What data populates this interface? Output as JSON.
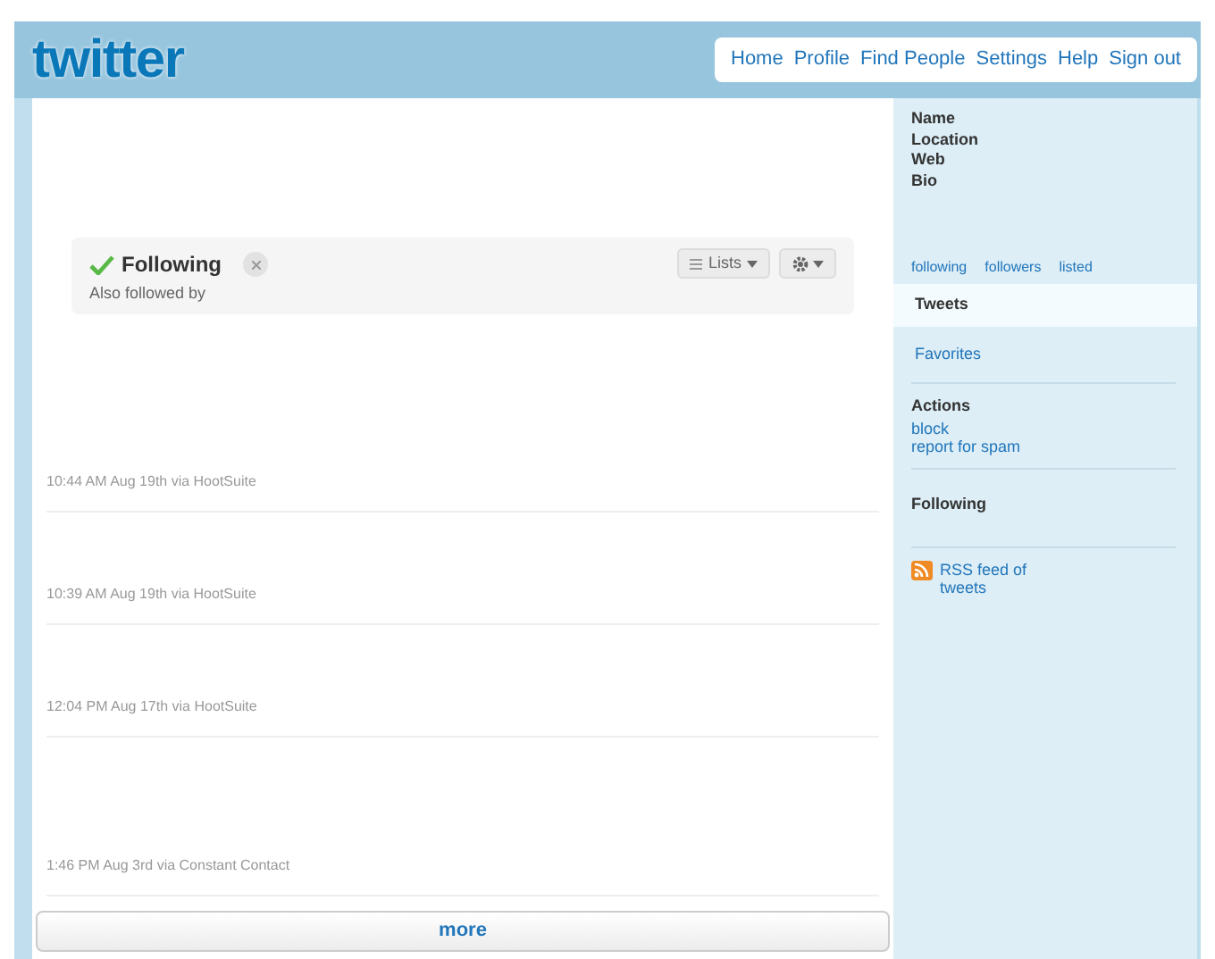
{
  "logo": "twitter",
  "nav": [
    {
      "label": "Home"
    },
    {
      "label": "Profile"
    },
    {
      "label": "Find People"
    },
    {
      "label": "Settings"
    },
    {
      "label": "Help"
    },
    {
      "label": "Sign out"
    }
  ],
  "relationship": {
    "status": "Following",
    "checked": true,
    "subtitle": "Also followed by",
    "lists_button": "Lists"
  },
  "tweets": [
    {
      "meta": "10:44 AM Aug 19th via HootSuite"
    },
    {
      "meta": "10:39 AM Aug 19th via HootSuite"
    },
    {
      "meta": "12:04 PM Aug 17th via HootSuite"
    },
    {
      "meta": "1:46 PM Aug 3rd via Constant Contact"
    }
  ],
  "more_button": "more",
  "sidebar": {
    "profile_fields": [
      "Name",
      "Location",
      "Web",
      "Bio"
    ],
    "stats": [
      "following",
      "followers",
      "listed"
    ],
    "tabs": [
      {
        "label": "Tweets",
        "selected": true
      },
      {
        "label": "Favorites",
        "selected": false
      }
    ],
    "actions_title": "Actions",
    "actions": [
      "block",
      "report for spam"
    ],
    "following_title": "Following",
    "rss": "RSS feed of tweets"
  }
}
